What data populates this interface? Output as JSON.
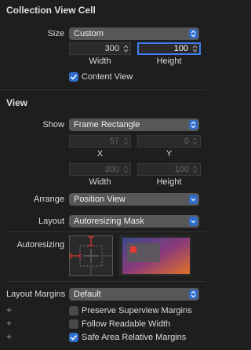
{
  "cell_section": {
    "title": "Collection View Cell",
    "size_label": "Size",
    "size_value": "Custom",
    "width_value": "300",
    "height_value": "100",
    "width_label": "Width",
    "height_label": "Height",
    "content_view_label": "Content View"
  },
  "view_section": {
    "title": "View",
    "show_label": "Show",
    "show_value": "Frame Rectangle",
    "x_value": "57",
    "y_value": "0",
    "x_label": "X",
    "y_label": "Y",
    "w_value": "300",
    "h_value": "100",
    "w_label": "Width",
    "h_label": "Height",
    "arrange_label": "Arrange",
    "arrange_value": "Position View",
    "layout_label": "Layout",
    "layout_value": "Autoresizing Mask",
    "autoresizing_label": "Autoresizing",
    "layout_margins_label": "Layout Margins",
    "layout_margins_value": "Default",
    "preserve_label": "Preserve Superview Margins",
    "follow_label": "Follow Readable Width",
    "safe_label": "Safe Area Relative Margins",
    "plus": "+"
  },
  "colors": {
    "accent": "#2f6ecb",
    "autoresize_red": "#e53935",
    "background": "#1e1e1e"
  }
}
